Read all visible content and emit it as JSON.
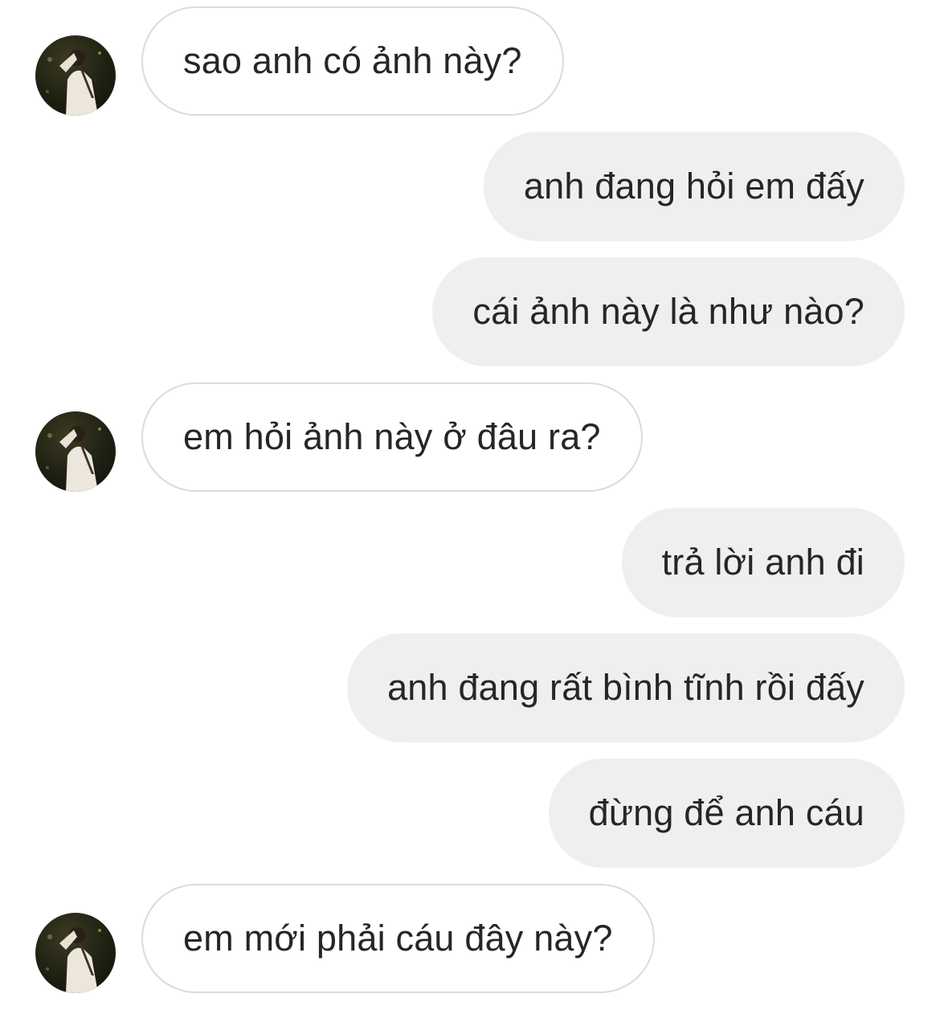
{
  "messages": [
    {
      "direction": "incoming",
      "text": "sao anh có ảnh này?"
    },
    {
      "direction": "outgoing",
      "text": "anh đang hỏi em đấy"
    },
    {
      "direction": "outgoing",
      "text": "cái ảnh này là như nào?"
    },
    {
      "direction": "incoming",
      "text": "em hỏi ảnh này ở đâu ra?"
    },
    {
      "direction": "outgoing",
      "text": "trả lời anh đi"
    },
    {
      "direction": "outgoing",
      "text": "anh đang rất bình tĩnh rồi đấy"
    },
    {
      "direction": "outgoing",
      "text": "đừng để anh cáu"
    },
    {
      "direction": "incoming",
      "text": "em mới phải cáu đây này?"
    }
  ],
  "colors": {
    "incoming_bubble_bg": "#ffffff",
    "incoming_bubble_border": "#dbdbdb",
    "outgoing_bubble_bg": "#efefef",
    "text": "#262626"
  }
}
